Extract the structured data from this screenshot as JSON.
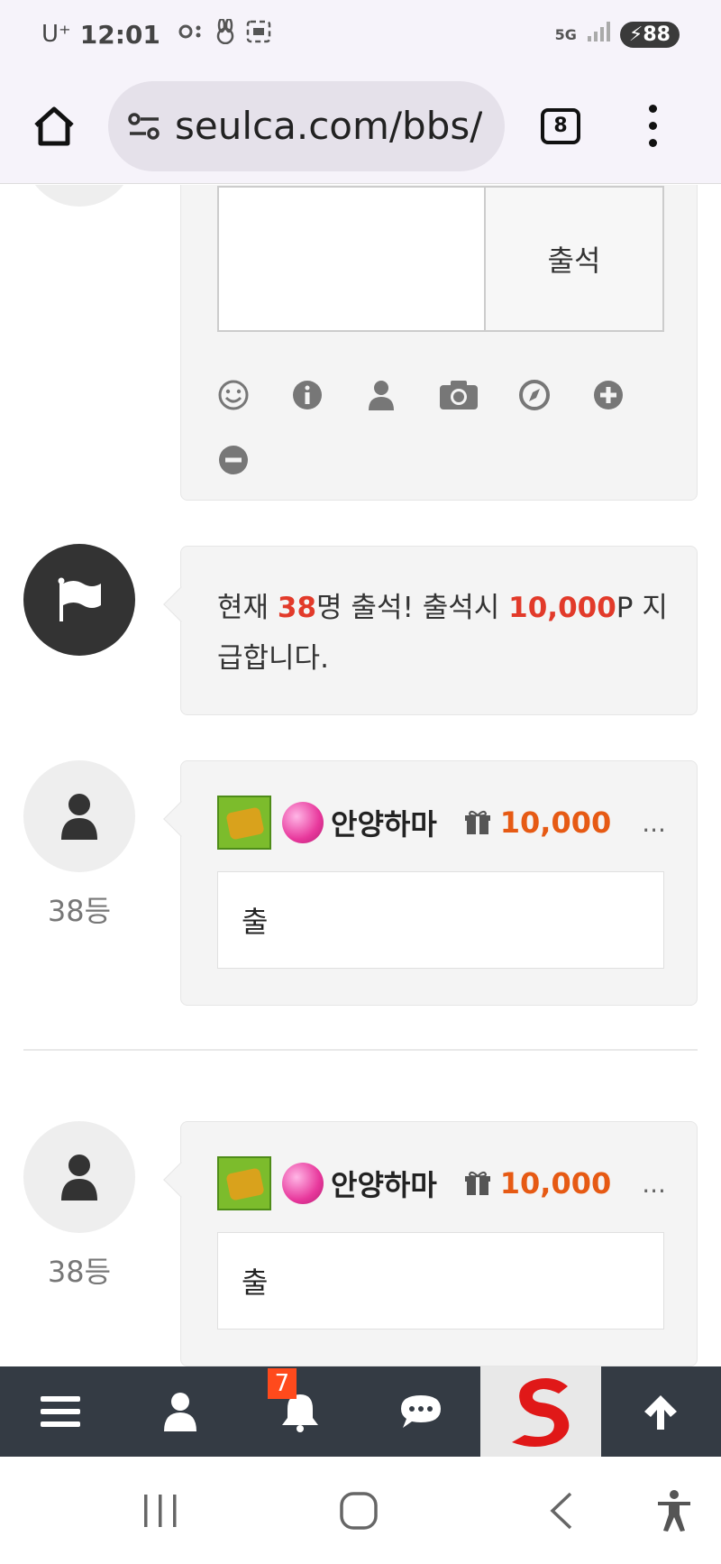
{
  "status_bar": {
    "carrier": "U⁺",
    "time": "12:01",
    "network": "5G",
    "battery": "88"
  },
  "browser": {
    "url": "seulca.com/bbs/",
    "tab_count": "8"
  },
  "compose": {
    "submit_label": "출석",
    "tools": [
      "emoji-icon",
      "info-icon",
      "user-icon",
      "camera-icon",
      "compass-icon",
      "plus-circle-icon",
      "minus-circle-icon"
    ]
  },
  "notice": {
    "prefix": "현재 ",
    "count": "38",
    "mid": "명 출석! 출석시 ",
    "points": "10,000",
    "suffix": "P 지급합니다."
  },
  "comments": [
    {
      "rank": "38등",
      "nickname": "안양하마",
      "points": "10,000",
      "more": "...",
      "body": "출"
    },
    {
      "rank": "38등",
      "nickname": "안양하마",
      "points": "10,000",
      "more": "...",
      "body": "출"
    }
  ],
  "app_bar": {
    "notification_count": "7",
    "items": [
      "menu-icon",
      "user-icon",
      "bell-icon",
      "chat-icon",
      "site-logo",
      "arrow-up-icon"
    ]
  },
  "colors": {
    "highlight_red": "#e23a2a",
    "points_orange": "#e65a14",
    "app_bar_bg": "#343b44",
    "badge_bg": "#ff4a1c"
  }
}
